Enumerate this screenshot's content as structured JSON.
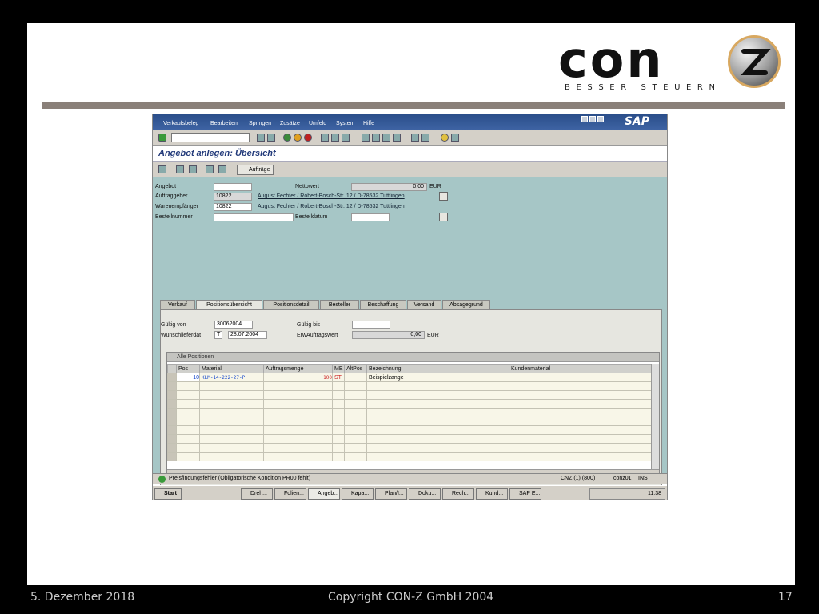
{
  "footer": {
    "date": "5. Dezember 2018",
    "copyright": "Copyright CON-Z GmbH 2004",
    "page": "17"
  },
  "logo": {
    "text": "con",
    "subtitle": "BESSER STEUERN",
    "mark_letter": "Z"
  },
  "sap": {
    "menu": [
      "Verkaufsbeleg",
      "Bearbeiten",
      "Springen",
      "Zusätze",
      "Umfeld",
      "System",
      "Hilfe"
    ],
    "brand": "SAP",
    "title": "Angebot anlegen: Übersicht",
    "toolbar2_button": "Aufträge",
    "header": {
      "angebot_label": "Angebot",
      "nettowert_label": "Nettowert",
      "nettowert_value": "0,00",
      "currency": "EUR",
      "auftraggeber_label": "Auftraggeber",
      "auftraggeber_value": "10822",
      "auftraggeber_link": "August Fechter / Robert-Bosch-Str. 12 / D-78532 Tuttlingen",
      "warenempfaenger_label": "Warenempfänger",
      "warenempfaenger_value": "10822",
      "warenempfaenger_link": "August Fechter / Robert-Bosch-Str. 12 / D-78532 Tuttlingen",
      "bestellnummer_label": "Bestellnummer",
      "bestelldatum_label": "Bestelldatum"
    },
    "tabs": [
      "Verkauf",
      "Positionsübersicht",
      "Positionsdetail",
      "Besteller",
      "Beschaffung",
      "Versand",
      "Absagegrund"
    ],
    "panel": {
      "gueltig_von_label": "Gültig von",
      "gueltig_von_value": "30062004",
      "gueltig_bis_label": "Gültig bis",
      "wunschliefer_label": "Wunschlieferdat",
      "wunschliefer_type": "T",
      "wunschliefer_value": "28.07.2004",
      "erwauftr_label": "ErwAuftragswert",
      "erwauftr_value": "0,00",
      "erwauftr_currency": "EUR"
    },
    "grid": {
      "title": "Alle Positionen",
      "columns": [
        "Pos",
        "Material",
        "Auftragsmenge",
        "ME",
        "AltPos",
        "Bezeichnung",
        "Kundenmaterial"
      ],
      "rows": [
        {
          "pos": "10",
          "material": "KLM-14-222-27-P",
          "menge": "100",
          "me": "ST",
          "altpos": "",
          "bez": "Beispielzange",
          "kunde": ""
        }
      ]
    },
    "status": {
      "message": "Preisfindungsfehler (Obligatorische Kondition PR00 fehlt)",
      "system": "CNZ (1) (800)",
      "user": "conz01",
      "mode": "INS"
    },
    "taskbar": {
      "start": "Start",
      "items": [
        "Dreh...",
        "Folien...",
        "Angeb...",
        "Kapa...",
        "Plan/I...",
        "Doku...",
        "Rech...",
        "Kund...",
        "SAP E..."
      ],
      "clock": "11:38"
    }
  }
}
